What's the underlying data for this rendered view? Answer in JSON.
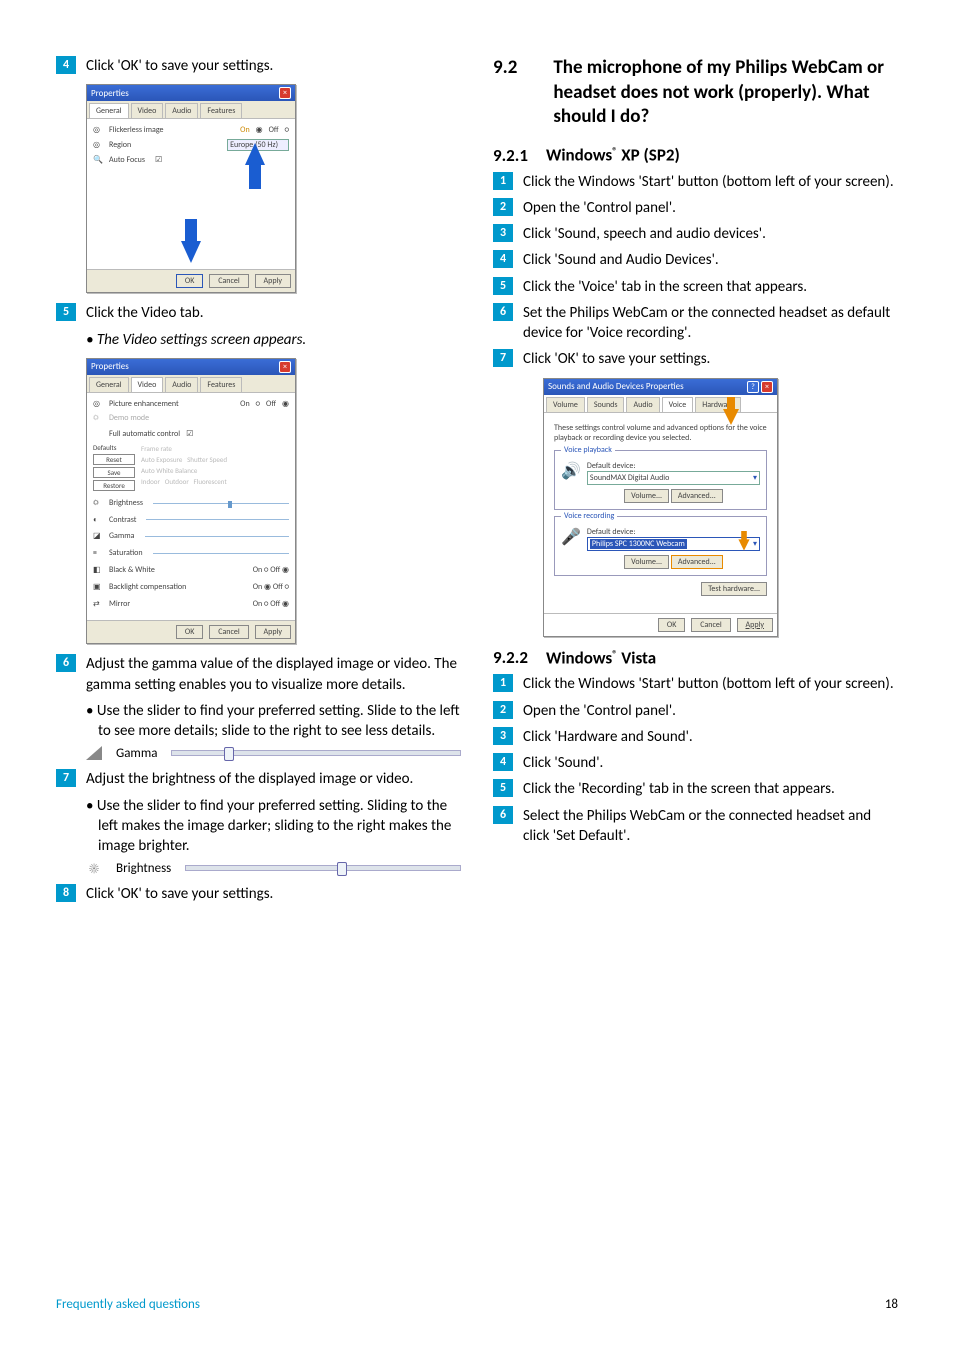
{
  "left": {
    "step4": {
      "num": "4",
      "text": "Click 'OK' to save your settings."
    },
    "step5": {
      "num": "5",
      "text": "Click the Video tab."
    },
    "step5_sub": "The Video settings screen appears.",
    "step6": {
      "num": "6",
      "text": "Adjust the gamma value of the displayed image or video.  The gamma setting enables you to visualize more details."
    },
    "step6_bullet": "Use the slider to find your preferred setting. Slide to the left to see more details; slide to the right to see less details.",
    "gamma_label": "Gamma",
    "step7": {
      "num": "7",
      "text": "Adjust the brightness of the displayed image or video."
    },
    "step7_bullet": "Use the slider to find your preferred setting. Sliding to the left makes the image darker; sliding to the right makes the image brighter.",
    "brightness_label": "Brightness",
    "step8": {
      "num": "8",
      "text": "Click 'OK' to save your settings."
    },
    "dlg_props_title": "Properties",
    "dlg_tabs": {
      "general": "General",
      "video": "Video",
      "audio": "Audio",
      "features": "Features"
    },
    "dlg1": {
      "flickerless": "Flickerless image",
      "on": "On",
      "off": "Off",
      "region": "Region",
      "region_val": "Europe (50 Hz)",
      "auto_focus": "Auto Focus"
    },
    "dlg2": {
      "picture_enh": "Picture enhancement",
      "on": "On",
      "off": "Off",
      "demo_mode": "Demo mode",
      "full_auto": "Full automatic control",
      "defaults": "Defaults",
      "reset": "Reset",
      "save": "Save",
      "restore": "Restore",
      "brightness": "Brightness",
      "contrast": "Contrast",
      "gamma": "Gamma",
      "saturation": "Saturation",
      "bw": "Black & White",
      "backlight": "Backlight compensation",
      "mirror": "Mirror"
    },
    "btn_ok": "OK",
    "btn_cancel": "Cancel",
    "btn_apply": "Apply"
  },
  "right": {
    "sec_num": "9.2",
    "sec_title": "The microphone of my Philips WebCam or headset does not work (properly). What should I do?",
    "sub1_num": "9.2.1",
    "sub1_title_a": "Windows",
    "sub1_title_b": " XP (SP2)",
    "sub1_steps": [
      "Click the Windows 'Start' button (bottom left of your screen).",
      "Open the 'Control panel'.",
      "Click 'Sound, speech and audio devices'.",
      "Click 'Sound and Audio Devices'.",
      "Click the 'Voice' tab in the screen that appears.",
      "Set the Philips WebCam or the connected headset as default device for 'Voice recording'.",
      "Click 'OK' to save your settings."
    ],
    "dlg3": {
      "title": "Sounds and Audio Devices Properties",
      "tabs": {
        "volume": "Volume",
        "sounds": "Sounds",
        "audio": "Audio",
        "voice": "Voice",
        "hardware": "Hardware"
      },
      "intro": "These settings control volume and advanced options for the voice playback or recording device you selected.",
      "playback_legend": "Voice playback",
      "default_device": "Default device:",
      "playback_val": "SoundMAX Digital Audio",
      "btn_volume": "Volume...",
      "btn_advanced": "Advanced...",
      "recording_legend": "Voice recording",
      "recording_val": "Philips SPC 1300NC Webcam",
      "btn_test": "Test hardware...",
      "btn_ok": "OK",
      "btn_cancel": "Cancel",
      "btn_apply": "Apply"
    },
    "sub2_num": "9.2.2",
    "sub2_title_a": "Windows",
    "sub2_title_b": " Vista",
    "sub2_steps": [
      "Click the Windows 'Start' button (bottom left of your screen).",
      "Open the 'Control panel'.",
      "Click 'Hardware and Sound'.",
      "Click 'Sound'.",
      "Click the 'Recording' tab in the screen that appears.",
      "Select the Philips WebCam or the connected headset and click 'Set Default'."
    ]
  },
  "footer": {
    "left": "Frequently asked questions",
    "right": "18"
  }
}
